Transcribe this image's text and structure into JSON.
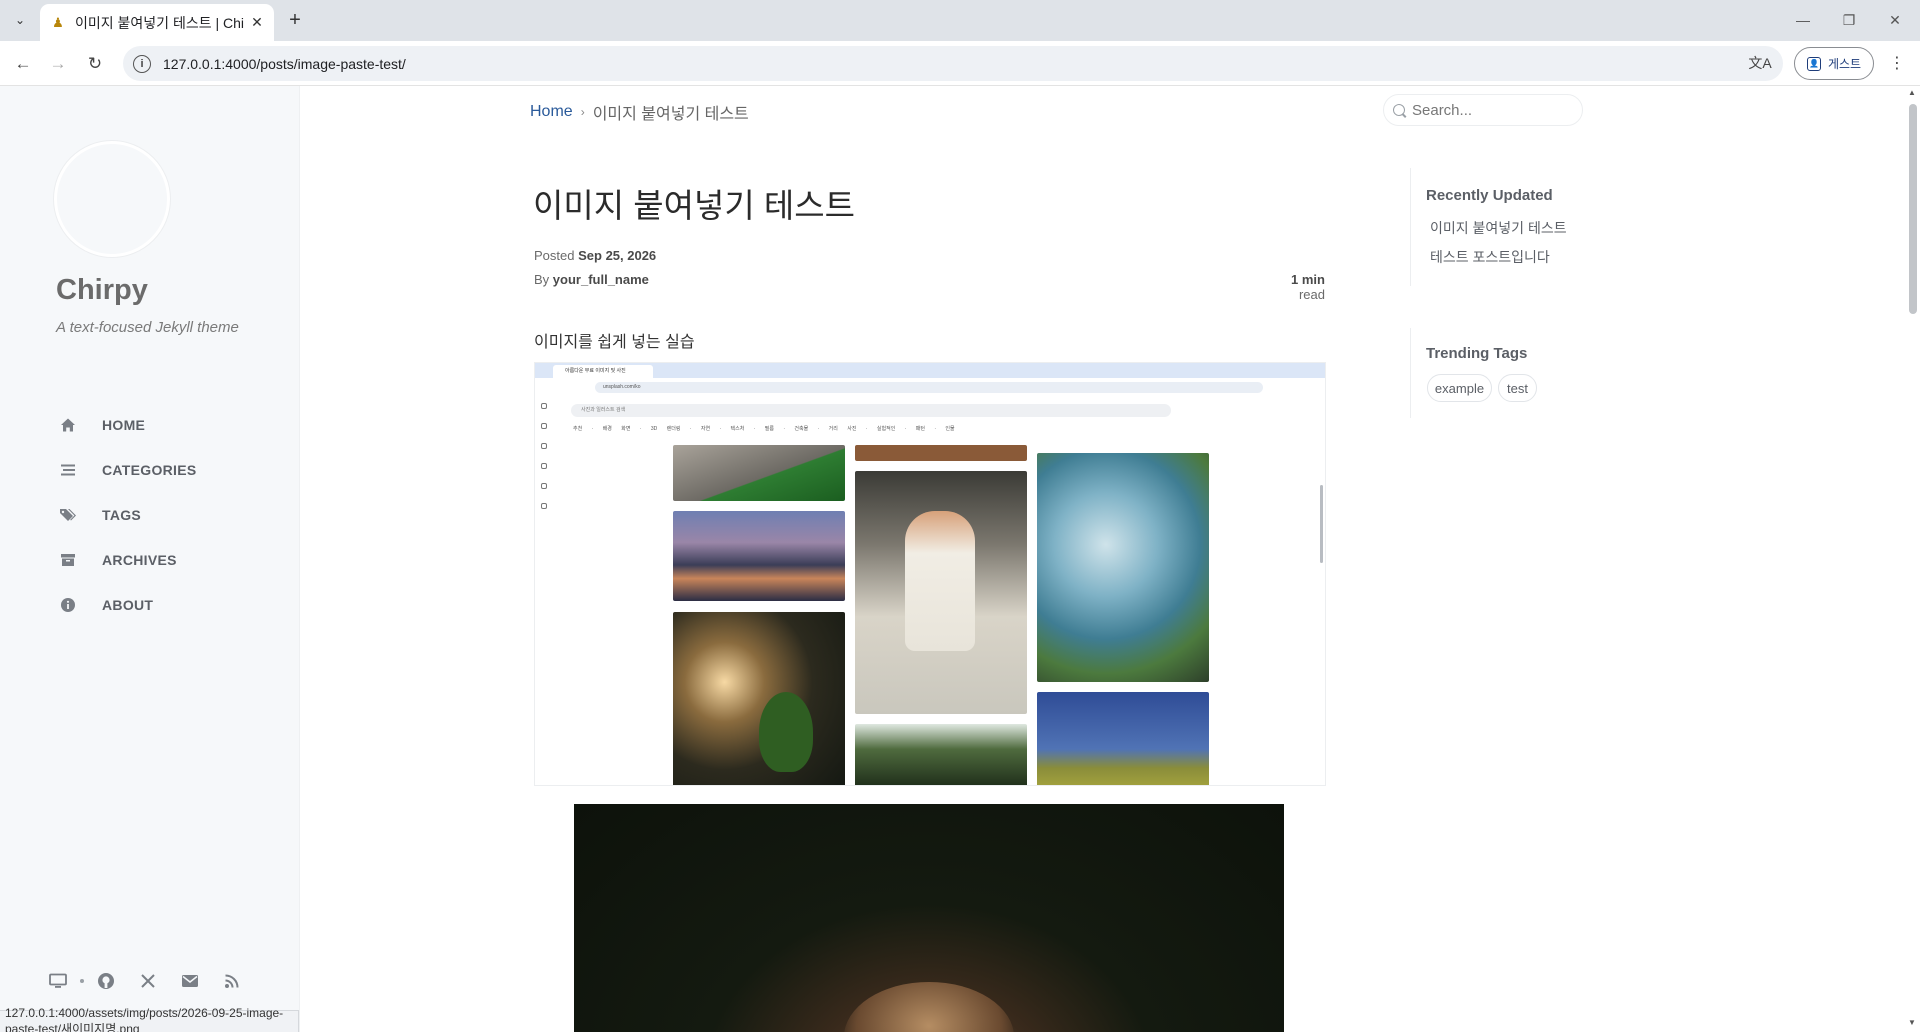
{
  "browser": {
    "tab_title": "이미지 붙여넣기 테스트 | Chirpy",
    "url": "127.0.0.1:4000/posts/image-paste-test/",
    "guest_label": "게스트",
    "status_url": "127.0.0.1:4000/assets/img/posts/2026-09-25-image-paste-test/새이미지명.png"
  },
  "sidebar": {
    "site_title": "Chirpy",
    "site_subtitle": "A text-focused Jekyll theme",
    "nav": [
      {
        "label": "HOME",
        "icon": "home-icon"
      },
      {
        "label": "CATEGORIES",
        "icon": "stream-icon"
      },
      {
        "label": "TAGS",
        "icon": "tags-icon"
      },
      {
        "label": "ARCHIVES",
        "icon": "archive-icon"
      },
      {
        "label": "ABOUT",
        "icon": "info-circle-icon"
      }
    ],
    "bottom_icons": [
      "theme-toggle-icon",
      "github-icon",
      "x-twitter-icon",
      "email-icon",
      "rss-icon"
    ]
  },
  "header": {
    "breadcrumb_home": "Home",
    "breadcrumb_current": "이미지 붙여넣기 테스트",
    "search_placeholder": "Search..."
  },
  "post": {
    "title": "이미지 붙여넣기 테스트",
    "posted_label": "Posted",
    "posted_date": "Sep 25, 2026",
    "by_label": "By",
    "author": "your_full_name",
    "read_minutes": "1 min",
    "read_label": "read",
    "body_text": "이미지를 쉽게 넣는 실습",
    "screenshot": {
      "tab_title": "아름다운 무료 이미지 및 사진",
      "url": "unsplash.com/ko",
      "search_placeholder": "사진과 일러스트 검색",
      "nav_items": "추천 · 배경 화면 · 3D 렌더링 · 자연 · 텍스처 · 필름 · 건축물 · 거리 사진 · 실험적인 · 패턴 · 인물"
    }
  },
  "panel": {
    "recently_updated_heading": "Recently Updated",
    "recently_updated": [
      "이미지 붙여넣기 테스트",
      "테스트 포스트입니다"
    ],
    "trending_tags_heading": "Trending Tags",
    "tags": [
      "example",
      "test"
    ]
  },
  "colors": {
    "link": "#2a5a9a",
    "sidebar_bg": "#f6f8fa"
  }
}
